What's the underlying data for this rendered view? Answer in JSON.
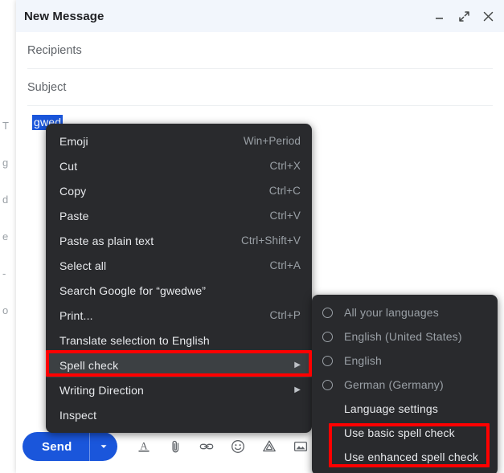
{
  "background": {
    "edge_letters": [
      "T",
      "g",
      "d",
      "e",
      "-",
      "o"
    ]
  },
  "compose": {
    "title": "New Message",
    "window_buttons": [
      {
        "name": "minimize-button",
        "icon": "minimize-icon"
      },
      {
        "name": "fullscreen-button",
        "icon": "expand-icon"
      },
      {
        "name": "close-button",
        "icon": "close-icon"
      }
    ],
    "recipients_placeholder": "Recipients",
    "subject_placeholder": "Subject",
    "body_selected_text": "gwed"
  },
  "toolbar": {
    "send_label": "Send",
    "send_color": "#1a56db",
    "send_options_icon": "chevron-down-icon",
    "icons": [
      {
        "name": "formatting-options-icon",
        "label": "Formatting options"
      },
      {
        "name": "attach-file-icon",
        "label": "Attach files"
      },
      {
        "name": "insert-link-icon",
        "label": "Insert link"
      },
      {
        "name": "insert-emoji-icon",
        "label": "Insert emoji"
      },
      {
        "name": "insert-drive-icon",
        "label": "Insert files using Drive"
      },
      {
        "name": "insert-photo-icon",
        "label": "Insert photo"
      }
    ]
  },
  "context_menu": {
    "items": [
      {
        "label": "Emoji",
        "shortcut": "Win+Period",
        "submenu": false,
        "highlighted": false
      },
      {
        "label": "Cut",
        "shortcut": "Ctrl+X",
        "submenu": false,
        "highlighted": false
      },
      {
        "label": "Copy",
        "shortcut": "Ctrl+C",
        "submenu": false,
        "highlighted": false
      },
      {
        "label": "Paste",
        "shortcut": "Ctrl+V",
        "submenu": false,
        "highlighted": false
      },
      {
        "label": "Paste as plain text",
        "shortcut": "Ctrl+Shift+V",
        "submenu": false,
        "highlighted": false
      },
      {
        "label": "Select all",
        "shortcut": "Ctrl+A",
        "submenu": false,
        "highlighted": false
      },
      {
        "label": "Search Google for “gwedwe”",
        "shortcut": "",
        "submenu": false,
        "highlighted": false
      },
      {
        "label": "Print...",
        "shortcut": "Ctrl+P",
        "submenu": false,
        "highlighted": false
      },
      {
        "label": "Translate selection to English",
        "shortcut": "",
        "submenu": false,
        "highlighted": false
      },
      {
        "label": "Spell check",
        "shortcut": "",
        "submenu": true,
        "highlighted": true
      },
      {
        "label": "Writing Direction",
        "shortcut": "",
        "submenu": true,
        "highlighted": false
      },
      {
        "label": "Inspect",
        "shortcut": "",
        "submenu": false,
        "highlighted": false
      }
    ]
  },
  "spell_check_submenu": {
    "items": [
      {
        "label": "All your languages",
        "radio": true,
        "selected": false,
        "disabled": true
      },
      {
        "label": "English (United States)",
        "radio": true,
        "selected": false,
        "disabled": true
      },
      {
        "label": "English",
        "radio": true,
        "selected": false,
        "disabled": true
      },
      {
        "label": "German (Germany)",
        "radio": true,
        "selected": false,
        "disabled": true
      },
      {
        "label": "Language settings",
        "radio": false,
        "selected": false,
        "disabled": false
      },
      {
        "label": "Use basic spell check",
        "radio": false,
        "selected": false,
        "disabled": false
      },
      {
        "label": "Use enhanced spell check",
        "radio": false,
        "selected": false,
        "disabled": false
      }
    ]
  },
  "annotations": {
    "color": "#ff0000",
    "boxes": [
      {
        "name": "spell-check-highlight"
      },
      {
        "name": "spell-check-options-highlight"
      }
    ]
  }
}
